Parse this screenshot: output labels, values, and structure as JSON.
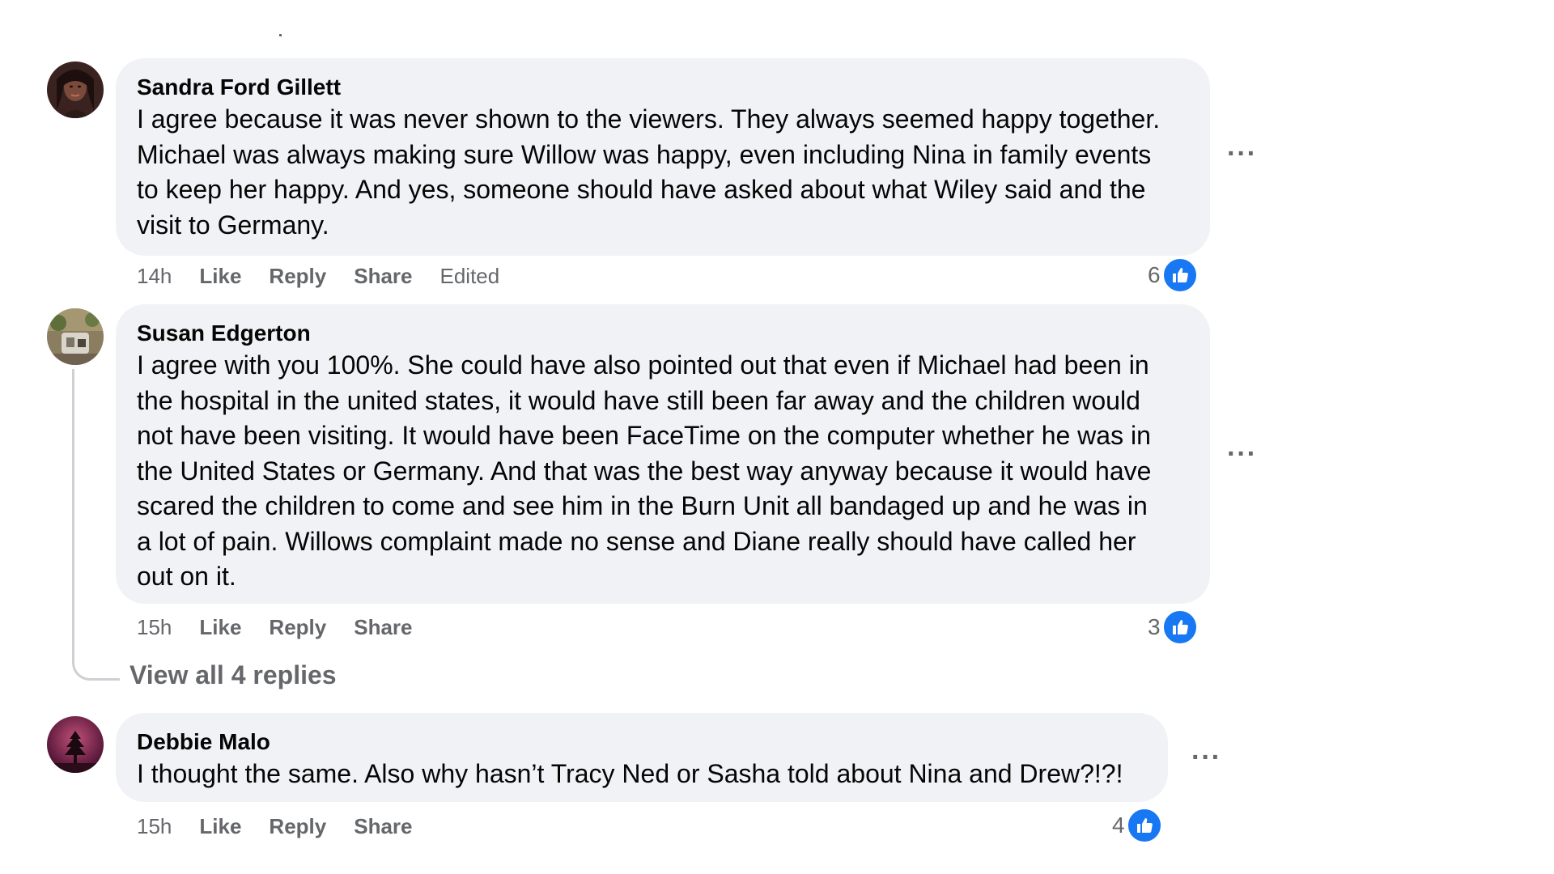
{
  "colors": {
    "bubble_bg": "#f0f2f5",
    "meta_text": "#65676b",
    "like_blue": "#1877f2"
  },
  "comments": [
    {
      "author": "Sandra Ford Gillett",
      "text_lines": [
        "I agree because it was never shown to the viewers. They always seemed happy together.",
        "Michael was always making sure Willow was happy, even including Nina in family events",
        "to keep her happy. And yes, someone should have asked about what Wiley said and the",
        "visit to Germany."
      ],
      "time": "14h",
      "like_label": "Like",
      "reply_label": "Reply",
      "share_label": "Share",
      "edited_label": "Edited",
      "reaction_count": "6",
      "reaction_icon": "thumbs-up-icon",
      "more_icon": "more-options-icon"
    },
    {
      "author": "Susan Edgerton",
      "text_lines": [
        "I agree with you 100%. She could have also pointed out that even if Michael had been in",
        "the hospital in the united states, it would have still been far away and the children would",
        "not have been visiting. It would have been FaceTime on the computer whether he was in",
        "the United States or Germany. And that was the best way anyway because it would have",
        "scared the children to come and see him in the Burn Unit all bandaged up and he was in",
        "a lot of pain. Willows complaint made no sense and Diane really should have called her",
        "out on it."
      ],
      "time": "15h",
      "like_label": "Like",
      "reply_label": "Reply",
      "share_label": "Share",
      "reaction_count": "3",
      "reaction_icon": "thumbs-up-icon",
      "more_icon": "more-options-icon",
      "view_replies": "View all 4 replies"
    },
    {
      "author": "Debbie Malo",
      "text_lines": [
        "I thought the same. Also why hasn’t Tracy Ned or Sasha told about Nina and Drew?!?!"
      ],
      "time": "15h",
      "like_label": "Like",
      "reply_label": "Reply",
      "share_label": "Share",
      "reaction_count": "4",
      "reaction_icon": "thumbs-up-icon",
      "more_icon": "more-options-icon"
    }
  ]
}
